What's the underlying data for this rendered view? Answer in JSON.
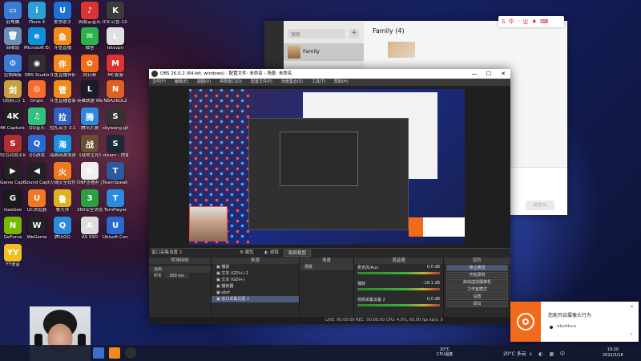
{
  "desktop": {
    "icons": [
      {
        "label": "此电脑",
        "color": "#3a7bd5",
        "glyph": "▭"
      },
      {
        "label": "iTools 4",
        "color": "#2a9fd8",
        "glyph": "i"
      },
      {
        "label": "爱思助手",
        "color": "#1e6fd9",
        "glyph": "U"
      },
      {
        "label": "网易云音乐",
        "color": "#d33",
        "glyph": "♪"
      },
      {
        "label": "ICK-公告-12-10.exe",
        "color": "#3c3c3c",
        "glyph": "K"
      },
      {
        "label": "回收站",
        "color": "#6a8fb8",
        "glyph": "🗑"
      },
      {
        "label": "Microsoft Edge",
        "color": "#0f8fd8",
        "glyph": "e"
      },
      {
        "label": "斗鱼直播",
        "color": "#f38a1c",
        "glyph": "鱼"
      },
      {
        "label": "微信",
        "color": "#2bb24c",
        "glyph": "✉"
      },
      {
        "label": "letsvpn",
        "color": "#e0e0e0",
        "glyph": "L"
      },
      {
        "label": "控制面板",
        "color": "#3a7bd5",
        "glyph": "⚙"
      },
      {
        "label": "OBS Studio",
        "color": "#302e31",
        "glyph": "◉"
      },
      {
        "label": "斗鱼直播伴侣",
        "color": "#f38a1c",
        "glyph": "伴"
      },
      {
        "label": "向日葵",
        "color": "#f26b1a",
        "glyph": "✿"
      },
      {
        "label": "MC客服",
        "color": "#d33",
        "glyph": "M"
      },
      {
        "label": "《剑网三》1",
        "color": "#c8a040",
        "glyph": "剑"
      },
      {
        "label": "Origin",
        "color": "#f56c2d",
        "glyph": "◎"
      },
      {
        "label": "斗鱼直播管家",
        "color": "#f38a1c",
        "glyph": "管"
      },
      {
        "label": "英雄联盟 WeGame版",
        "color": "#1a1a2a",
        "glyph": "L"
      },
      {
        "label": "NBA2KOL2",
        "color": "#e06020",
        "glyph": "N"
      },
      {
        "label": "4K Capture Utility",
        "color": "#222",
        "glyph": "4K"
      },
      {
        "label": "QQ音乐",
        "color": "#31c27c",
        "glyph": "♫"
      },
      {
        "label": "拉扎高手 3.1",
        "color": "#3060c0",
        "glyph": "拉"
      },
      {
        "label": "腾讯手游",
        "color": "#2a8ae0",
        "glyph": "腾"
      },
      {
        "label": "skywang.gif",
        "color": "#333",
        "glyph": "S"
      },
      {
        "label": "SCG对战平台",
        "color": "#b03030",
        "glyph": "S"
      },
      {
        "label": "QQ游戏",
        "color": "#2a6ad0",
        "glyph": "Q"
      },
      {
        "label": "海豚网游加速器",
        "color": "#1a90e0",
        "glyph": "海"
      },
      {
        "label": "《战地生死》IDM联盟",
        "color": "#6a5030",
        "glyph": "战"
      },
      {
        "label": "steam - 快捷方式",
        "color": "#1b2838",
        "glyph": "S"
      },
      {
        "label": "Game Capture HD",
        "color": "#222",
        "glyph": "▶"
      },
      {
        "label": "Sound Capture",
        "color": "#222",
        "glyph": "◀"
      },
      {
        "label": "火绒安全软件",
        "color": "#f07820",
        "glyph": "火"
      },
      {
        "label": "DNF查看补丁",
        "color": "#eee",
        "glyph": "D"
      },
      {
        "label": "TeamSpeak 3",
        "color": "#2a5aa0",
        "glyph": "T"
      },
      {
        "label": "GeeGee",
        "color": "#1a1a1a",
        "glyph": "G"
      },
      {
        "label": "UC浏览器",
        "color": "#f07820",
        "glyph": "U"
      },
      {
        "label": "鲁大师",
        "color": "#e0b020",
        "glyph": "鲁"
      },
      {
        "label": "360安全浏览",
        "color": "#2aa040",
        "glyph": "3"
      },
      {
        "label": "TomPlayer",
        "color": "#2a8ae0",
        "glyph": "T"
      },
      {
        "label": "GeForce",
        "color": "#76b900",
        "glyph": "N"
      },
      {
        "label": "WeGame",
        "color": "#222",
        "glyph": "W"
      },
      {
        "label": "腾讯QQ",
        "color": "#2a8ae0",
        "glyph": "Q"
      },
      {
        "label": "AS SSD",
        "color": "#ddd",
        "glyph": "A"
      },
      {
        "label": "Ubisoft Connect",
        "color": "#2a6ad0",
        "glyph": "U"
      },
      {
        "label": "YY语音",
        "color": "#f0c020",
        "glyph": "YY"
      }
    ]
  },
  "wechat": {
    "search_placeholder": "搜索",
    "add_glyph": "+",
    "chat_name": "Family",
    "title": "Family (4)",
    "send_label": "发送(S)",
    "ime_glyphs": "S 中 · ㄓ ♦ ⌨"
  },
  "obs": {
    "title": "OBS 26.0.2 (64-bit, windows) - 配置文件: 未命名 - 场景: 未命名",
    "menu": [
      "文件(F)",
      "编辑(E)",
      "视图(V)",
      "停靠窗口(D)",
      "配置文件(P)",
      "场景集合(S)",
      "工具(T)",
      "帮助(H)"
    ],
    "source_bar": {
      "source_name": "窗口采集设置 2",
      "properties": "属性",
      "filters": "滤镜",
      "screenshot": "截屏截图"
    },
    "docks": {
      "transition": {
        "title": "转场特效",
        "type": "淡出",
        "duration_label": "时长",
        "duration": "300 ms"
      },
      "sources": {
        "title": "来源",
        "items": [
          "捕获",
          "文本 (GDI+) 2",
          "文本 (GDI+)",
          "捕获器",
          "obsf",
          "窗口采集设置 2"
        ]
      },
      "scenes": {
        "title": "场景",
        "items": [
          "场景"
        ]
      },
      "mixer": {
        "title": "混音器",
        "channels": [
          {
            "name": "麦克风/Aux",
            "db": "0.0 dB"
          },
          {
            "name": "捕获",
            "db": "-18.1 dB"
          },
          {
            "name": "视频采集设备 2",
            "db": "0.0 dB"
          }
        ]
      },
      "controls": {
        "title": "控件",
        "buttons": [
          "停止推流",
          "开始录制",
          "启动虚拟摄像机",
          "工作室模式",
          "设置",
          "退出"
        ]
      }
    },
    "status": "LIVE: 00:00:00   REC: 00:00:00   CPU: 4.0%, 60.00 fps   kb/s: 0"
  },
  "notification": {
    "title": "您能开启摄像头行为",
    "item": "obsfdsce",
    "close_glyph": "✕"
  },
  "taskbar": {
    "weather_temp": "20°C",
    "weather_text": "CPU温度",
    "temp_label": "20°C 多云",
    "tray_glyphs": "∧ ◐ ▦ 中",
    "time": "19:20",
    "date": "2022/3/18"
  }
}
